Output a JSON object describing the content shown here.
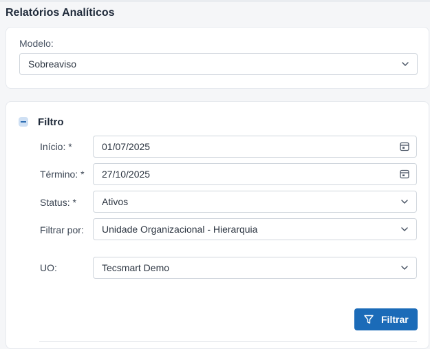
{
  "page": {
    "title": "Relatórios Analíticos"
  },
  "model": {
    "label": "Modelo:",
    "value": "Sobreaviso"
  },
  "filter": {
    "title": "Filtro",
    "fields": {
      "inicio": {
        "label": "Início: *",
        "value": "01/07/2025",
        "icon": "calendar-icon"
      },
      "termino": {
        "label": "Término: *",
        "value": "27/10/2025",
        "icon": "calendar-icon"
      },
      "status": {
        "label": "Status: *",
        "value": "Ativos"
      },
      "filtrar_por": {
        "label": "Filtrar por:",
        "value": "Unidade Organizacional - Hierarquia"
      },
      "uo": {
        "label": "UO:",
        "value": "Tecsmart Demo"
      }
    },
    "button": {
      "label": "Filtrar",
      "icon": "funnel-icon",
      "color": "#1b6bb8"
    }
  }
}
